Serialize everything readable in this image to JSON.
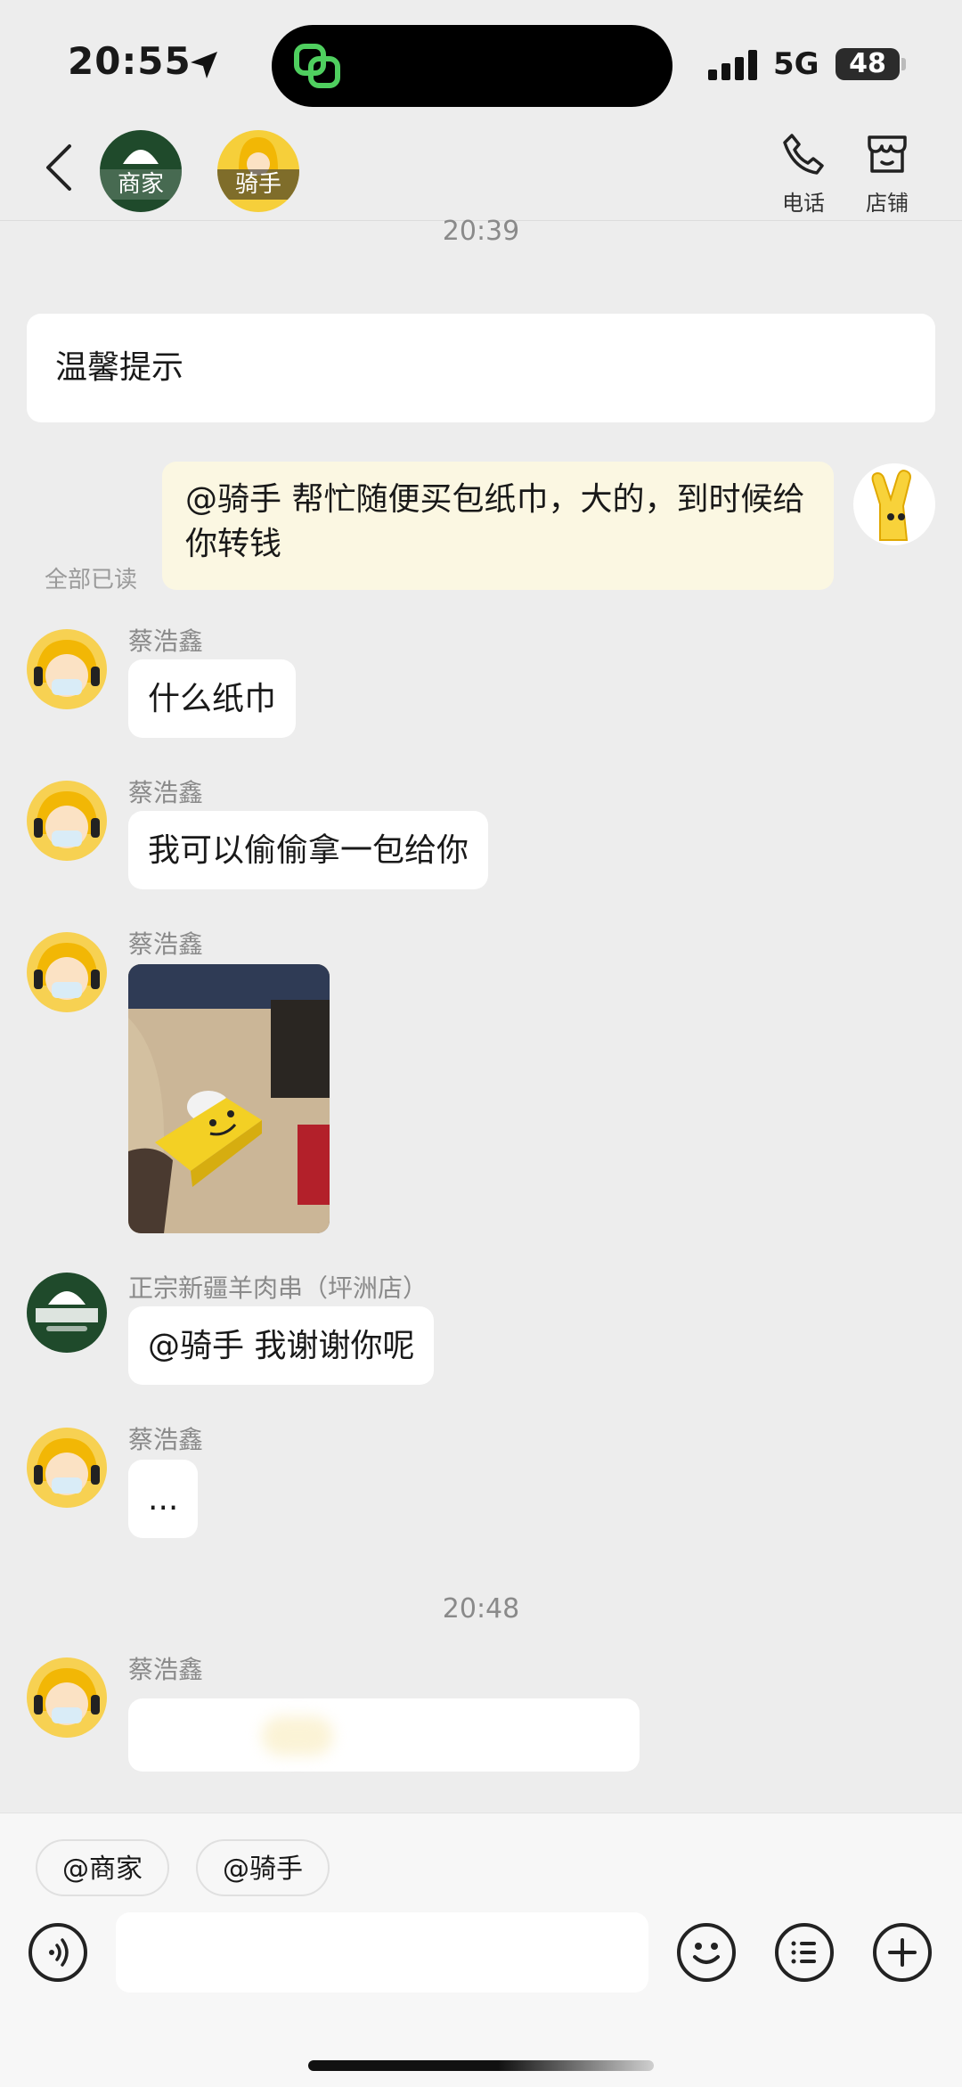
{
  "status_bar": {
    "time": "20:55",
    "network": "5G",
    "battery": "48"
  },
  "header": {
    "merchant_tag": "商家",
    "rider_tag": "骑手",
    "phone_label": "电话",
    "store_label": "店铺"
  },
  "timestamps": [
    "20:39",
    "20:48"
  ],
  "tip_card": {
    "text": "温馨提示"
  },
  "messages": {
    "my_message": {
      "text": "@骑手 帮忙随便买包纸巾，大的，到时候给你转钱",
      "read_status": "全部已读"
    },
    "rider_name": "蔡浩鑫",
    "merchant_name": "正宗新疆羊肉串（坪洲店）",
    "m1": "什么纸巾",
    "m2": "我可以偷偷拿一包给你",
    "m4": "@骑手 我谢谢你呢",
    "m5": "..."
  },
  "quick_mentions": [
    "@商家",
    "@骑手"
  ],
  "input": {
    "placeholder": ""
  },
  "colors": {
    "background": "#ededed",
    "my_bubble": "#fbf7e2",
    "merchant_green": "#1f4a2b",
    "rider_yellow": "#f7d152"
  }
}
